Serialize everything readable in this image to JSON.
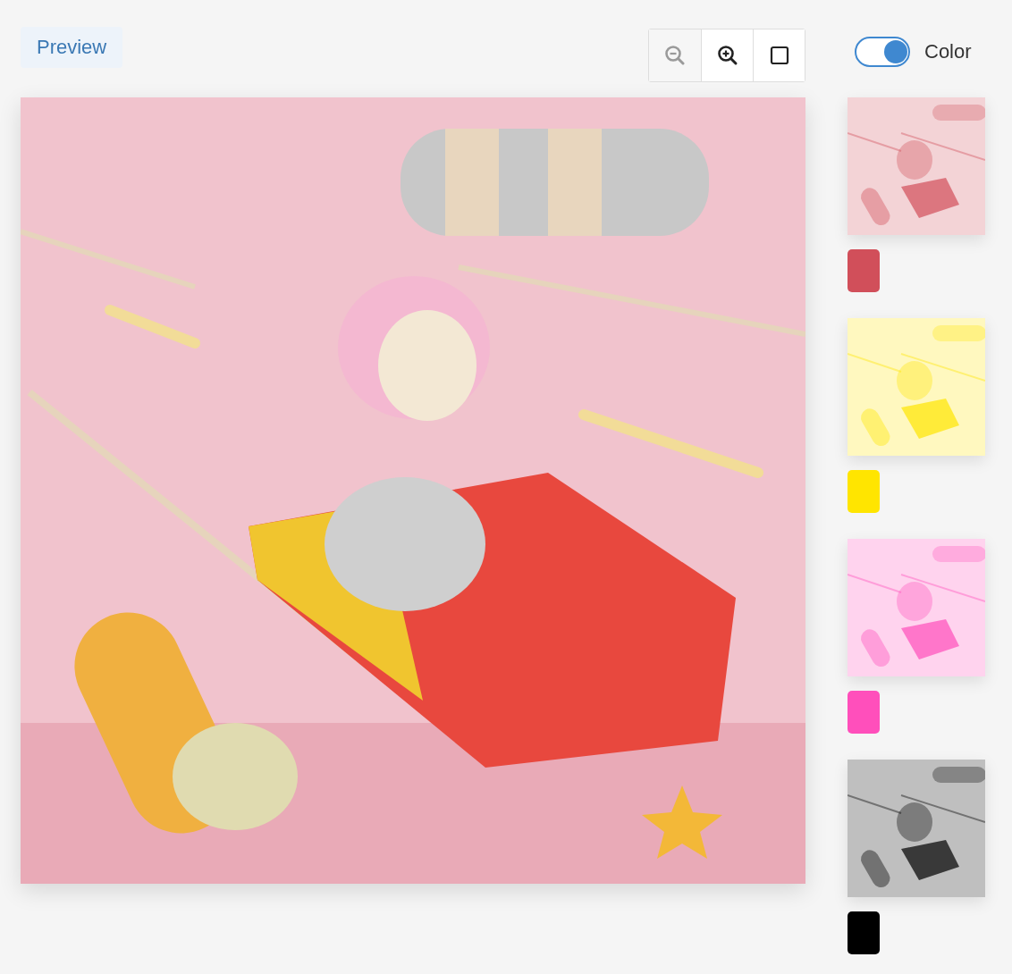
{
  "preview": {
    "label": "Preview"
  },
  "toolbar": [
    {
      "kind": "zoom-out",
      "disabled": true
    },
    {
      "kind": "zoom-in",
      "disabled": false
    },
    {
      "kind": "fit",
      "disabled": false
    }
  ],
  "color_toggle": {
    "label": "Color",
    "on": true
  },
  "variants": [
    {
      "color": "#d14f5a"
    },
    {
      "color": "#ffe500"
    },
    {
      "color": "#ff4fbb"
    },
    {
      "color": "#000000"
    }
  ]
}
